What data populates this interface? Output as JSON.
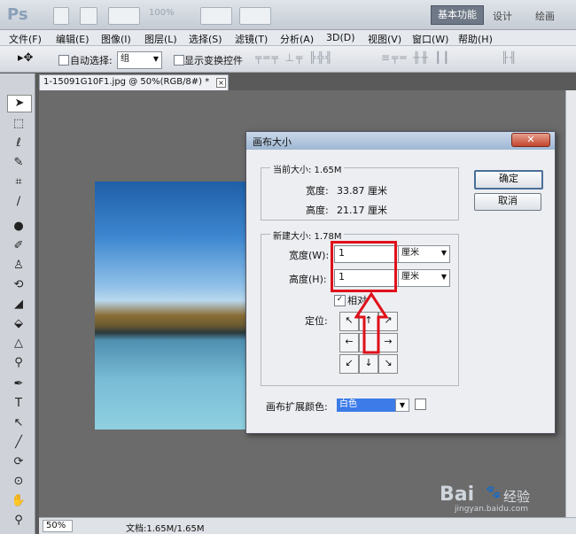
{
  "app": {
    "logo": "Ps",
    "zoom": "100%"
  },
  "workspace": {
    "active": "基本功能",
    "design": "设计",
    "paint": "绘画"
  },
  "menu": [
    "文件(F)",
    "编辑(E)",
    "图像(I)",
    "图层(L)",
    "选择(S)",
    "滤镜(T)",
    "分析(A)",
    "3D(D)",
    "视图(V)",
    "窗口(W)",
    "帮助(H)"
  ],
  "options": {
    "auto_select_label": "自动选择:",
    "auto_select_value": "组",
    "show_transform_label": "显示变换控件"
  },
  "document": {
    "tab_title": "1-15091G10F1.jpg @ 50%(RGB/8#) *",
    "close": "×"
  },
  "status": {
    "zoom": "50%",
    "doc_info": "文档:1.65M/1.65M"
  },
  "dialog": {
    "title": "画布大小",
    "close": "✕",
    "current_size_label": "当前大小: 1.65M",
    "current_width_label": "宽度:",
    "current_width_value": "33.87 厘米",
    "current_height_label": "高度:",
    "current_height_value": "21.17 厘米",
    "new_size_label": "新建大小: 1.78M",
    "width_label": "宽度(W):",
    "width_value": "1",
    "width_unit": "厘米",
    "height_label": "高度(H):",
    "height_value": "1",
    "height_unit": "厘米",
    "relative_label": "相对",
    "anchor_label": "定位:",
    "ok": "确定",
    "cancel": "取消",
    "ext_color_label": "画布扩展颜色:",
    "ext_color_value": "白色"
  },
  "watermark": {
    "brand": "Bai",
    "brand2": "经验",
    "url": "jingyan.baidu.com"
  },
  "colors": {
    "highlight": "#e0101a",
    "selection": "#3c7be8"
  }
}
